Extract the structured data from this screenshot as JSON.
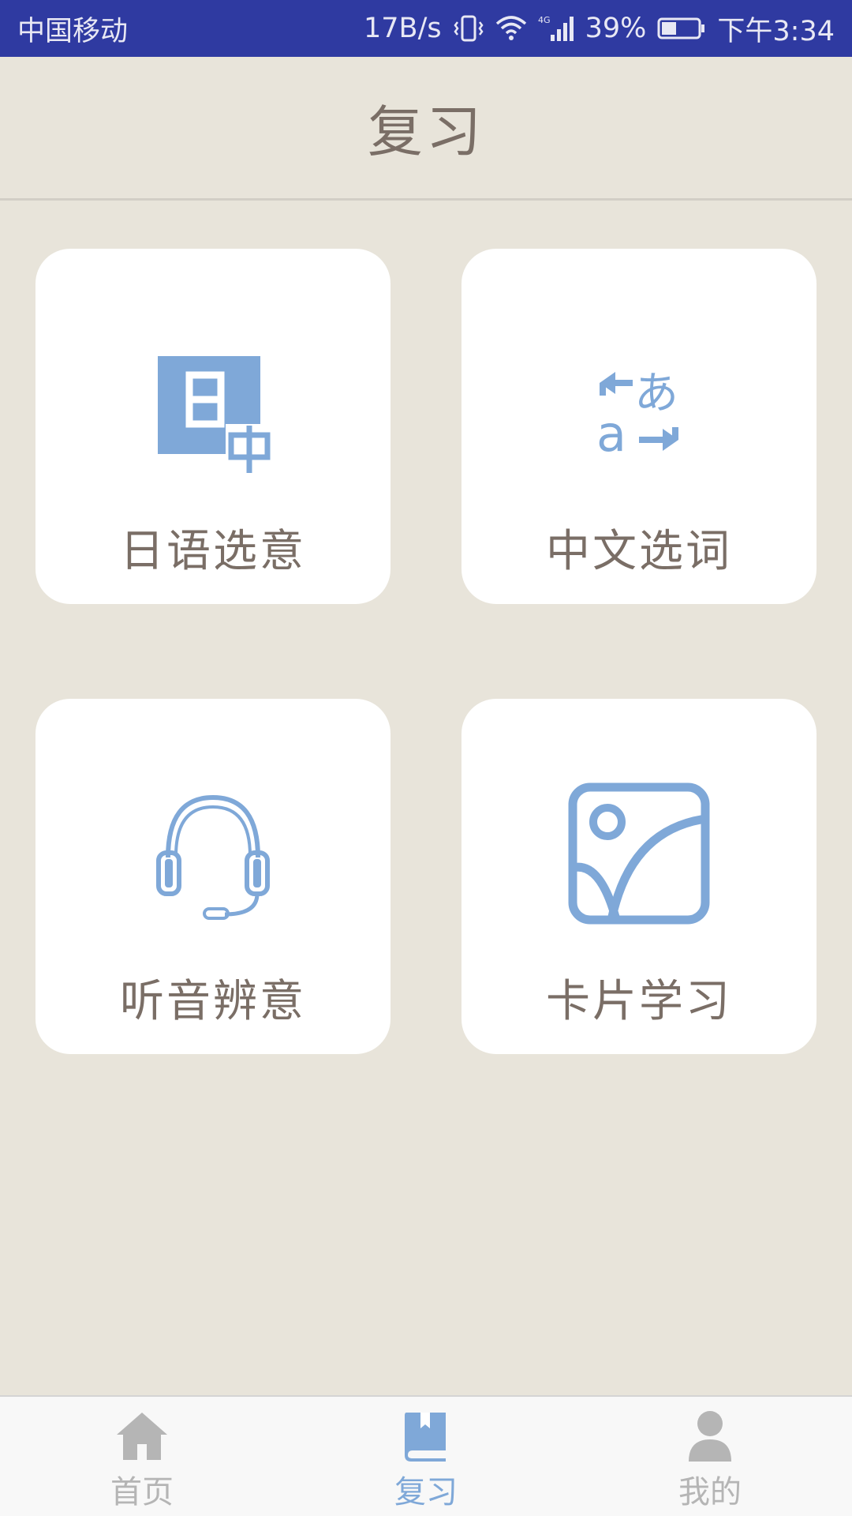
{
  "status_bar": {
    "carrier": "中国移动",
    "net_speed": "17B/s",
    "battery": "39%",
    "time": "下午3:34"
  },
  "header": {
    "title": "复习"
  },
  "cards": [
    {
      "label": "日语选意",
      "icon": "jp-zh-translate-icon"
    },
    {
      "label": "中文选词",
      "icon": "language-swap-icon"
    },
    {
      "label": "听音辨意",
      "icon": "headset-icon"
    },
    {
      "label": "卡片学习",
      "icon": "picture-card-icon"
    }
  ],
  "bottom_nav": {
    "items": [
      {
        "label": "首页",
        "icon": "home-icon",
        "active": false
      },
      {
        "label": "复习",
        "icon": "book-icon",
        "active": true
      },
      {
        "label": "我的",
        "icon": "user-icon",
        "active": false
      }
    ]
  },
  "colors": {
    "status_bar": "#2f3aa1",
    "background": "#e8e4da",
    "accent": "#7fa8d8",
    "text": "#7a6e66",
    "inactive": "#b5b5b5"
  }
}
